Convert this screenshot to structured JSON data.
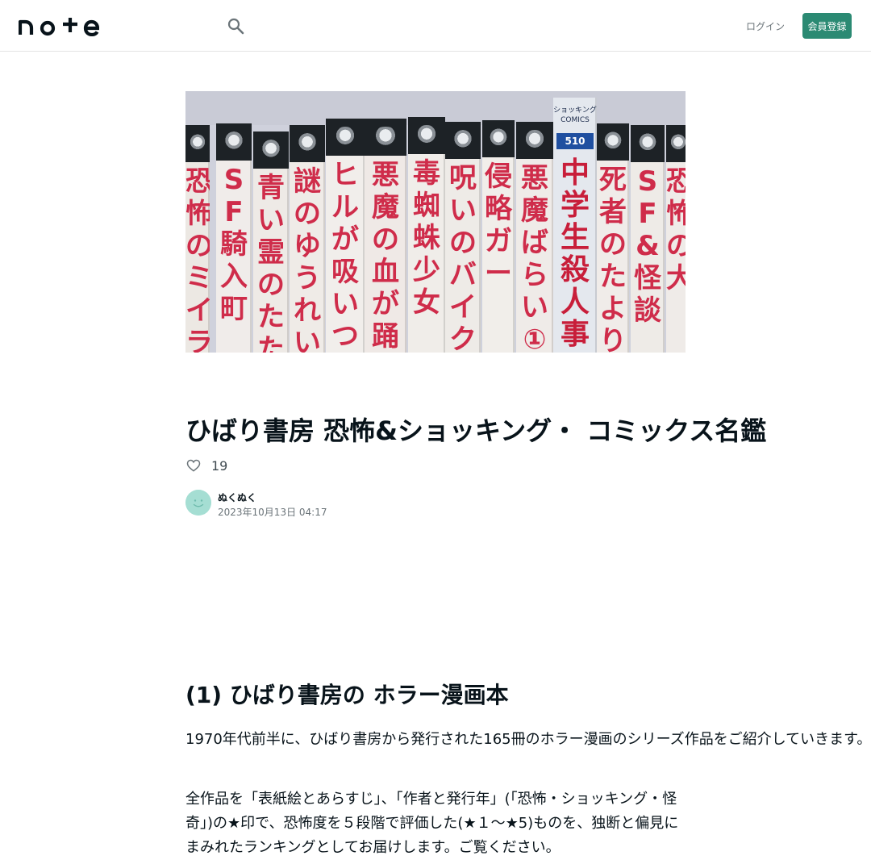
{
  "header": {
    "logo_text": "note",
    "search_icon": "search-icon",
    "login_label": "ログイン",
    "signup_label": "会員登録"
  },
  "hero": {
    "description": "Spines of vintage manga books on a shelf",
    "spines": [
      {
        "text": "恐怖のミイラ"
      },
      {
        "text": "SF騎入町"
      },
      {
        "text": "青い霊のたたり"
      },
      {
        "text": "謎のゆうれい船"
      },
      {
        "text": "ヒルが吸いつく"
      },
      {
        "text": "悪魔の血が踊る"
      },
      {
        "text": "毒蜘蛛少女"
      },
      {
        "text": "呪いのバイク"
      },
      {
        "text": "侵略ガー"
      },
      {
        "text": "悪魔ばらい①"
      },
      {
        "text": "中学生殺人事"
      },
      {
        "text": "死者のたより"
      },
      {
        "text": "SF&怪談"
      },
      {
        "text": "恐怖の大"
      }
    ],
    "comics_label": "ショッキング COMICS",
    "comics_number": "510"
  },
  "article": {
    "title": "ひばり書房 恐怖&ショッキング・ コミックス名鑑",
    "like_count": "19",
    "author": "ぬくぬく",
    "date": "2023年10月13日 04:17",
    "section_heading": "(1) ひばり書房の ホラー漫画本",
    "paragraph1": "1970年代前半に、ひばり書房から発行された165冊のホラー漫画のシリーズ作品をご紹介していきます。",
    "paragraph2": "全作品を「表紙絵とあらすじ」、「作者と発行年」(「恐怖・ショッキング・怪奇」)の★印で、恐怖度を５段階で評価した(★１〜★5)ものを、独断と偏見にまみれたランキングとしてお届けします。ご覧ください。"
  },
  "colors": {
    "brand": "#2b8a73",
    "spine_red": "#cf2c4a",
    "avatar": "#a5ded3"
  }
}
